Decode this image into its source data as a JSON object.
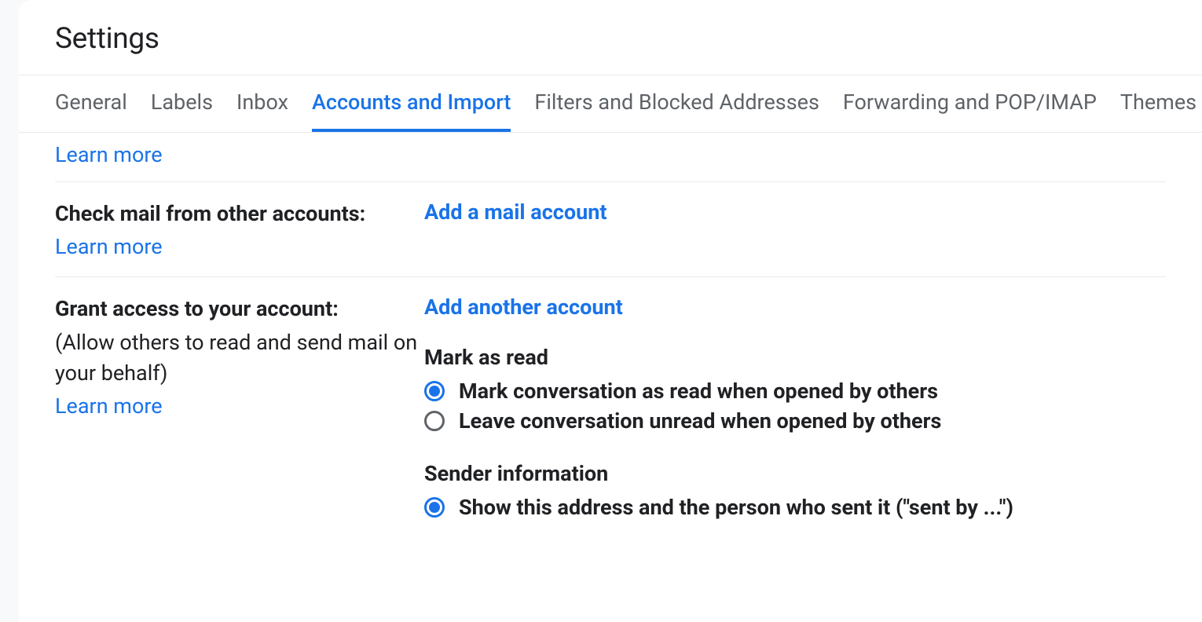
{
  "page": {
    "title": "Settings"
  },
  "tabs": [
    {
      "label": "General"
    },
    {
      "label": "Labels"
    },
    {
      "label": "Inbox"
    },
    {
      "label": "Accounts and Import",
      "active": true
    },
    {
      "label": "Filters and Blocked Addresses"
    },
    {
      "label": "Forwarding and POP/IMAP"
    },
    {
      "label": "Themes"
    }
  ],
  "links": {
    "learn_more": "Learn more"
  },
  "sections": {
    "check_mail": {
      "label": "Check mail from other accounts:",
      "action": "Add a mail account"
    },
    "grant_access": {
      "label": "Grant access to your account:",
      "sublabel": "(Allow others to read and send mail on your behalf)",
      "action": "Add another account",
      "mark_as_read": {
        "heading": "Mark as read",
        "options": [
          {
            "label": "Mark conversation as read when opened by others",
            "checked": true
          },
          {
            "label": "Leave conversation unread when opened by others",
            "checked": false
          }
        ]
      },
      "sender_info": {
        "heading": "Sender information",
        "options": [
          {
            "label": "Show this address and the person who sent it (\"sent by ...\")",
            "checked": true
          }
        ]
      }
    }
  }
}
